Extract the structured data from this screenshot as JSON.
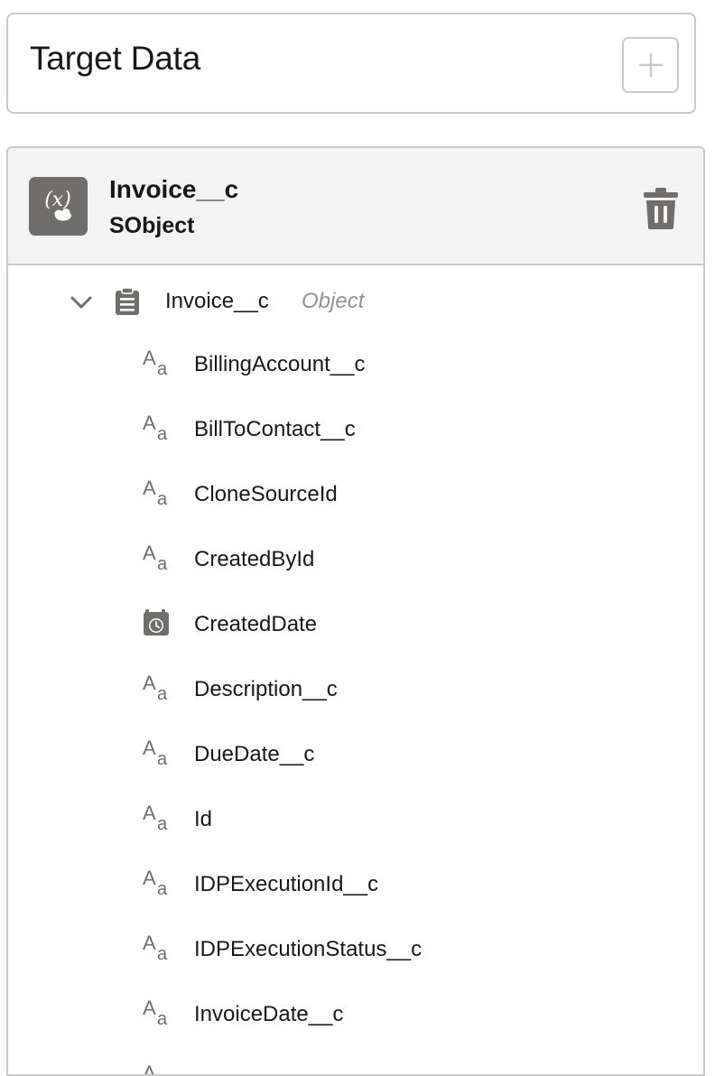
{
  "header": {
    "title": "Target Data",
    "add_icon": "plus-icon"
  },
  "variable": {
    "icon": "variable-icon",
    "name": "Invoice__c",
    "type": "SObject",
    "delete_icon": "trash-icon"
  },
  "tree": {
    "root_label": "Invoice__c",
    "root_type": "Object",
    "expanded": true,
    "fields": [
      {
        "label": "BillingAccount__c",
        "icon": "text-icon"
      },
      {
        "label": "BillToContact__c",
        "icon": "text-icon"
      },
      {
        "label": "CloneSourceId",
        "icon": "text-icon"
      },
      {
        "label": "CreatedById",
        "icon": "text-icon"
      },
      {
        "label": "CreatedDate",
        "icon": "datetime-icon"
      },
      {
        "label": "Description__c",
        "icon": "text-icon"
      },
      {
        "label": "DueDate__c",
        "icon": "text-icon"
      },
      {
        "label": "Id",
        "icon": "text-icon"
      },
      {
        "label": "IDPExecutionId__c",
        "icon": "text-icon"
      },
      {
        "label": "IDPExecutionStatus__c",
        "icon": "text-icon"
      },
      {
        "label": "InvoiceDate__c",
        "icon": "text-icon"
      },
      {
        "label": "",
        "icon": "text-icon"
      }
    ]
  },
  "colors": {
    "border": "#c9c9c9",
    "header_bg": "#f3f3f3",
    "icon_gray": "#706e6b",
    "muted_text": "#939393"
  }
}
